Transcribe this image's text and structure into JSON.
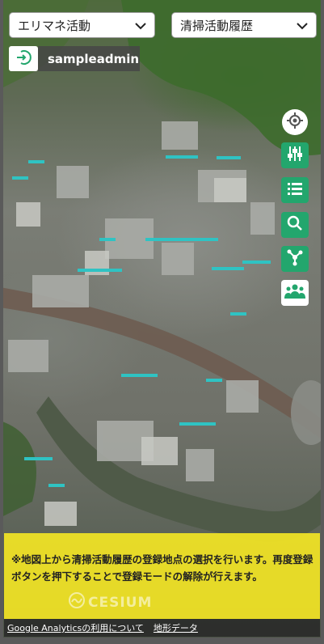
{
  "selects": {
    "area": {
      "value": "エリマネ活動"
    },
    "history": {
      "value": "清掃活動履歴"
    }
  },
  "user": {
    "name": "sampleadmin"
  },
  "notice": {
    "text": "※地図上から清掃活動履歴の登録地点の選択を行います。再度登録ボタンを押下することで登録モードの解除が行えます。"
  },
  "attribution": {
    "brand": "CESIUM"
  },
  "footer": {
    "analytics_link": "Google Analyticsの利用について",
    "terrain_link": "地形データ"
  },
  "colors": {
    "accent": "#23a66d",
    "notice_bg": "#f6e824"
  },
  "icons": [
    "locate-icon",
    "sliders-icon",
    "list-icon",
    "search-icon",
    "share-icon",
    "users-icon",
    "logout-icon",
    "chevron-down-icon"
  ]
}
